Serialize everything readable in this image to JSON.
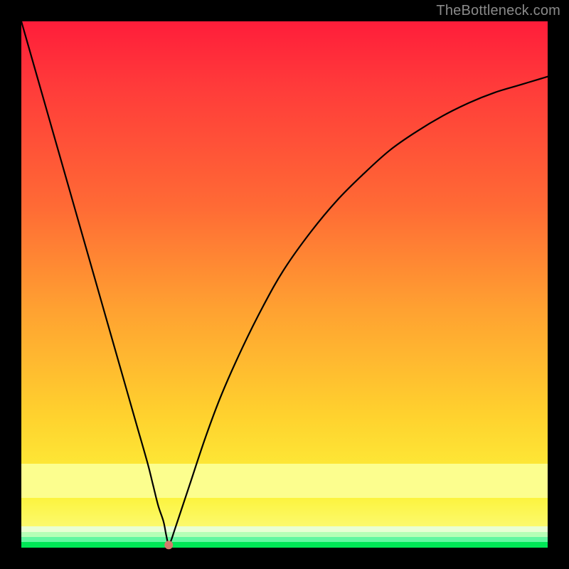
{
  "watermark_text": "TheBottleneck.com",
  "chart_data": {
    "type": "line",
    "title": "",
    "xlabel": "",
    "ylabel": "",
    "xlim": [
      0,
      100
    ],
    "ylim": [
      0,
      100
    ],
    "grid": false,
    "legend": null,
    "background": "red-yellow-green vertical gradient (red top, green bottom)",
    "series": [
      {
        "name": "bottleneck-curve",
        "x": [
          0,
          2,
          4,
          6,
          8,
          10,
          12,
          14,
          16,
          18,
          20,
          22,
          24,
          25,
          26,
          27,
          27.5,
          28,
          28.5,
          29,
          30,
          32,
          35,
          38,
          42,
          46,
          50,
          55,
          60,
          65,
          70,
          75,
          80,
          85,
          90,
          95,
          100
        ],
        "y": [
          100,
          93,
          86,
          79,
          72,
          65,
          58,
          51,
          44,
          37,
          30,
          23,
          16,
          12,
          8,
          5,
          2.5,
          0.5,
          1.5,
          3,
          6,
          12,
          21,
          29,
          38,
          46,
          53,
          60,
          66,
          71,
          75.5,
          79,
          82,
          84.5,
          86.5,
          88,
          89.5
        ]
      }
    ],
    "marker": {
      "name": "minimum-point",
      "x": 28,
      "y": 0.5,
      "color": "#d47a6b"
    }
  }
}
